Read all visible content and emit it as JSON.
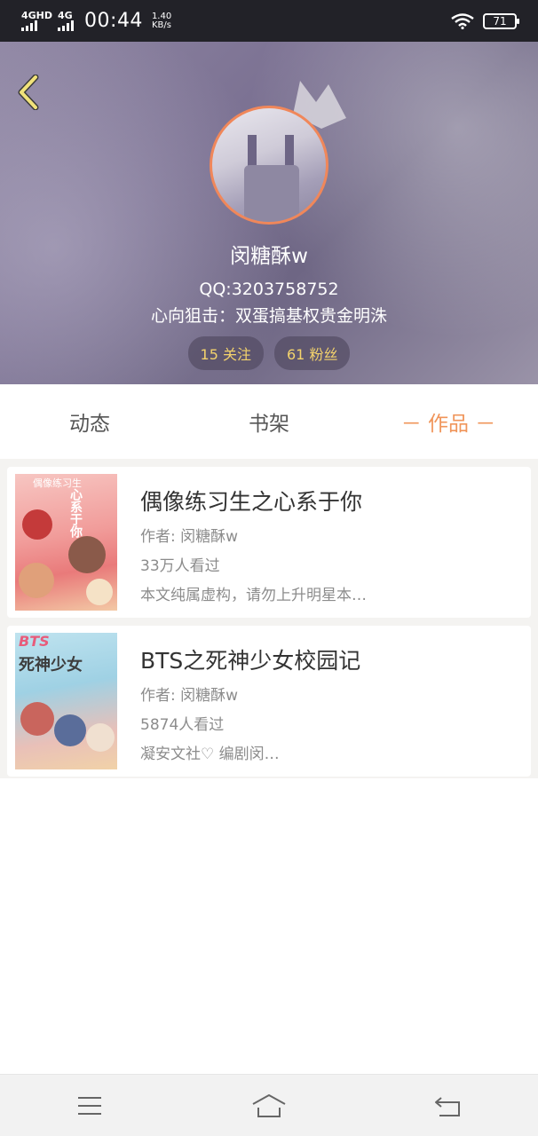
{
  "status_bar": {
    "signal1": "4GHD",
    "signal2": "4G",
    "time": "00:44",
    "speed_value": "1.40",
    "speed_unit": "KB/s",
    "battery": "71"
  },
  "profile": {
    "name": "闵糖酥w",
    "qq": "QQ:3203758752",
    "bio": "心向狙击：双蛋搞基权贵金明洙",
    "following": "15 关注",
    "followers": "61 粉丝"
  },
  "tabs": [
    {
      "label": "动态"
    },
    {
      "label": "书架"
    },
    {
      "label": "－ 作品 －"
    }
  ],
  "books": [
    {
      "title": "偶像练习生之心系于你",
      "author": "作者: 闵糖酥w",
      "views": "33万人看过",
      "desc": "本文纯属虚构，请勿上升明星本…",
      "cover_text": "偶像练习生",
      "cover_text2": "心系于你"
    },
    {
      "title": "BTS之死神少女校园记",
      "author": "作者: 闵糖酥w",
      "views": "5874人看过",
      "desc": "凝安文社♡ 编剧闵…",
      "cover_text": "BTS",
      "cover_text2": "死神少女"
    }
  ],
  "icons": {
    "back": "chevron-left-icon",
    "menu": "menu-icon",
    "home": "home-icon",
    "return": "return-icon"
  },
  "colors": {
    "accent": "#f0955a",
    "stat_text": "#f4d36c",
    "avatar_border": "#f0875a"
  }
}
